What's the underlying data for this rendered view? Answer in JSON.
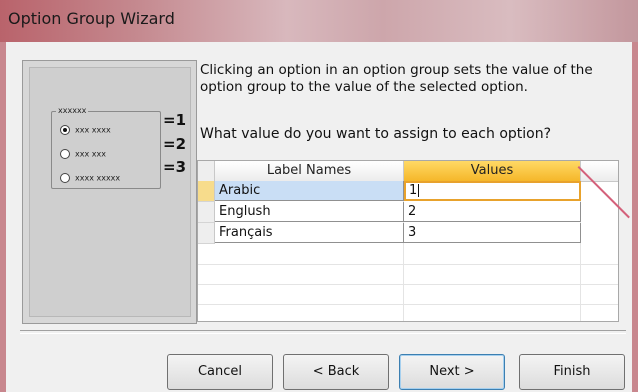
{
  "window": {
    "title": "Option Group Wizard"
  },
  "preview": {
    "legend": "xxxxxx",
    "options": [
      {
        "label": "xxx xxxx",
        "selected": true,
        "value_label": "=1"
      },
      {
        "label": "xxx xxx",
        "selected": false,
        "value_label": "=2"
      },
      {
        "label": "xxxx xxxxx",
        "selected": false,
        "value_label": "=3"
      }
    ]
  },
  "description": "Clicking an option in an option group sets the value of the option group to the value of the selected option.",
  "question": "What value do you want to assign to each option?",
  "grid": {
    "headers": {
      "label": "Label Names",
      "values": "Values"
    },
    "rows": [
      {
        "label": "Arabic",
        "value": "1"
      },
      {
        "label": "Englush",
        "value": "2"
      },
      {
        "label": "Français",
        "value": "3"
      }
    ]
  },
  "buttons": {
    "cancel": "Cancel",
    "back": "< Back",
    "next": "Next >",
    "finish": "Finish"
  },
  "colors": {
    "title_bar": "#c58a90",
    "selected_header": "#f5b72a",
    "selected_row": "#c9def5"
  }
}
